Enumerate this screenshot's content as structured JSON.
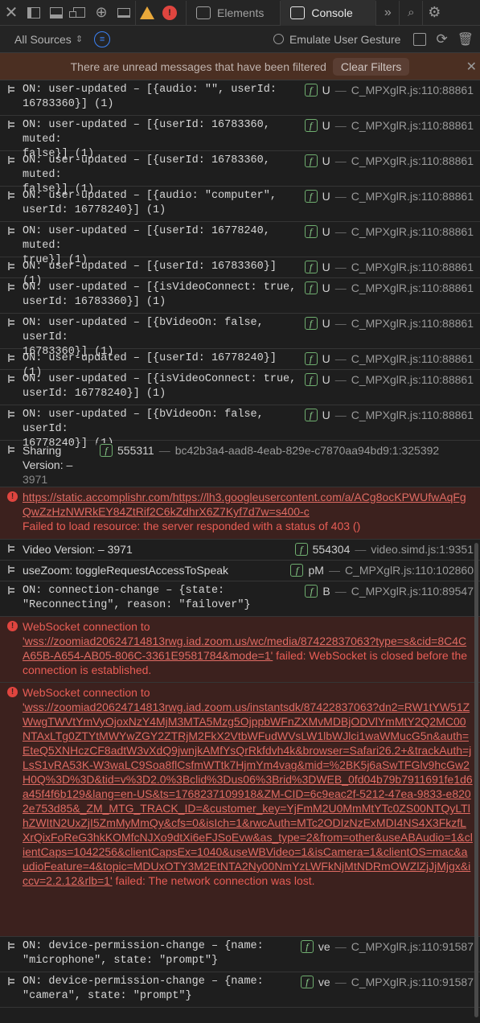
{
  "toolbar": {
    "tabs": [
      {
        "label": "Elements"
      },
      {
        "label": "Console"
      }
    ],
    "error_badge": "!",
    "more": "»"
  },
  "filter": {
    "sources_label": "All Sources",
    "emulate_label": "Emulate User Gesture"
  },
  "banner": {
    "message": "There are unread messages that have been filtered",
    "clear_label": "Clear Filters"
  },
  "rows": [
    {
      "lines": [
        "ON: user-updated – [{audio: \"\", userId: ",
        "16783360}] (1)"
      ],
      "fn": "U",
      "loc": "C_MPXglR.js:110:88861"
    },
    {
      "lines": [
        "ON: user-updated – [{userId: 16783360, muted: ",
        "false}] (1)"
      ],
      "fn": "U",
      "loc": "C_MPXglR.js:110:88861"
    },
    {
      "lines": [
        "ON: user-updated – [{userId: 16783360, muted: ",
        "false}] (1)"
      ],
      "fn": "U",
      "loc": "C_MPXglR.js:110:88861"
    },
    {
      "lines": [
        "ON: user-updated – [{audio: \"computer\", ",
        "userId: 16778240}] (1)"
      ],
      "fn": "U",
      "loc": "C_MPXglR.js:110:88861"
    },
    {
      "lines": [
        "ON: user-updated – [{userId: 16778240, muted: ",
        "true}] (1)"
      ],
      "fn": "U",
      "loc": "C_MPXglR.js:110:88861"
    },
    {
      "lines": [
        "ON: user-updated – [{userId: 16783360}] (1)"
      ],
      "fn": "U",
      "loc": "C_MPXglR.js:110:88861"
    },
    {
      "lines": [
        "ON: user-updated – [{isVideoConnect: true, ",
        "userId: 16783360}] (1)"
      ],
      "fn": "U",
      "loc": "C_MPXglR.js:110:88861"
    },
    {
      "lines": [
        "ON: user-updated – [{bVideoOn: false, userId: ",
        "16783360}] (1)"
      ],
      "fn": "U",
      "loc": "C_MPXglR.js:110:88861"
    },
    {
      "lines": [
        "ON: user-updated – [{userId: 16778240}] (1)"
      ],
      "fn": "U",
      "loc": "C_MPXglR.js:110:88861"
    },
    {
      "lines": [
        "ON: user-updated – [{isVideoConnect: true, ",
        "userId: 16778240}] (1)"
      ],
      "fn": "U",
      "loc": "C_MPXglR.js:110:88861"
    },
    {
      "lines": [
        "ON: user-updated – [{bVideoOn: false, userId: ",
        "16778240}] (1)"
      ],
      "fn": "U",
      "loc": "C_MPXglR.js:110:88861"
    }
  ],
  "sharing": {
    "line1": "Sharing",
    "line2": "Version: –",
    "line3": "3971",
    "fn": "555311",
    "loc": "bc42b3a4-aad8-4eab-829e-c7870aa94bd9:1:325392"
  },
  "error1": {
    "url": "https://static.accomplishr.com/https://lh3.googleusercontent.com/a/ACg8ocKPWUfwAqFgQwZzHzNWRkEY84ZtRif2C6kZdhrX6Z7Kyf7d7w=s400-c",
    "message": "Failed to load resource: the server responded with a status of 403 ()"
  },
  "video": {
    "label": "Video Version: – 3971",
    "fn": "554304",
    "loc": "video.simd.js:1:9351"
  },
  "zoom": {
    "label": "useZoom: toggleRequestAccessToSpeak",
    "fn": "pM",
    "loc": "C_MPXglR.js:110:102860"
  },
  "conn": {
    "line1": "ON: connection-change – {state: ",
    "line2": "\"Reconnecting\", reason: \"failover\"}",
    "fn": "B",
    "loc": "C_MPXglR.js:110:89547"
  },
  "ws1": {
    "prefix": "WebSocket connection to",
    "url": "'wss://zoomiad20624714813rwg.iad.zoom.us/wc/media/87422837063?type=s&cid=8C4CA65B-A654-AB05-806C-3361E9581784&mode=1'",
    "suffix": " failed: WebSocket is closed before the connection is established."
  },
  "ws2": {
    "prefix": "WebSocket connection to",
    "url": "'wss://zoomiad20624714813rwg.iad.zoom.us/instantsdk/87422837063?dn2=RW1tYW51ZWwgTWVtYmVyOjoxNzY4MjM3MTA5Mzg5OjppbWFnZXMvMDBjODVlYmMtY2Q2MC00NTAxLTg0ZTYtMWYwZGY2ZTRjM2FkX2VtbWFudWVsLW1lbWJlci1waWMucG5n&auth=EteQ5XNHczCF8adtW3vXdQ9jwnjkAMfYsQrRkfdvh4k&browser=Safari26.2+&trackAuth=jLsS1vRA53K-W3waLC9Soa8flCsfmWTtk7HjmYm4vag&mid=%2BK5j6aSwTFGlv9hcGw2H0Q%3D%3D&tid=v%3D2.0%3Bclid%3Dus06%3Brid%3DWEB_0fd04b79b7911691fe1d6a45f4f6b129&lang=en-US&ts=1768237109918&ZM-CID=6c9eac2f-5212-47ea-9833-e8202e753d85&_ZM_MTG_TRACK_ID=&customer_key=YjFmM2U0MmMtYTc0ZS00NTQyLTlhZWItN2UxZjI5ZmMyMmQy&cfs=0&isIch=1&rwcAuth=MTc2ODIzNzExMDI4NS4X3FkzfLXrQixFoReG3hkKOMfcNJXo9dtXi6eFJSoEvw&as_type=2&from=other&useABAudio=1&clientCaps=1042256&clientCapsEx=1040&useWBVideo=1&isCamera=1&clientOS=mac&audioFeature=4&topic=MDUxOTY3M2EtNTA2Ny00NmYzLWFkNjMtNDRmOWZlZjJjMjgx&iccv=2.2.12&rlb=1'",
    "suffix": " failed: The network connection was lost."
  },
  "perm1": {
    "line1": "ON: device-permission-change – {name: ",
    "line2": "\"microphone\", state: \"prompt\"}",
    "fn": "ve",
    "loc": "C_MPXglR.js:110:91587"
  },
  "perm2": {
    "line1": "ON: device-permission-change – {name: ",
    "line2": "\"camera\", state: \"prompt\"}",
    "fn": "ve",
    "loc": "C_MPXglR.js:110:91587"
  }
}
